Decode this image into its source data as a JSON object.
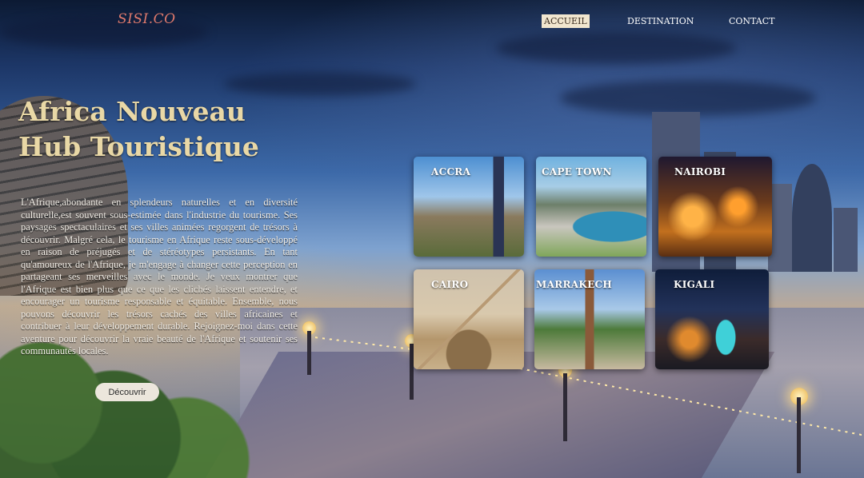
{
  "header": {
    "logo": "SISI.CO",
    "nav": [
      {
        "label": "ACCUEIL",
        "active": true
      },
      {
        "label": "DESTINATION",
        "active": false
      },
      {
        "label": "CONTACT",
        "active": false
      }
    ]
  },
  "hero": {
    "title_line1": "Africa Nouveau",
    "title_line2": "Hub Touristique",
    "paragraph": "L'Afrique,abondante en splendeurs naturelles et en diversité culturelle,est souvent sous-estimée dans l'industrie du tourisme. Ses paysages spectaculaires et ses villes animées regorgent de trésors à découvrir. Malgré cela, le tourisme en Afrique reste sous-développé en raison de préjugés et de stéréotypes persistants. En tant qu'amoureux de l'Afrique, je m'engage à changer cette perception en partageant ses merveilles avec le monde. Je veux montrer que l'Afrique est bien plus que ce que les clichés laissent entendre, et encourager un tourisme responsable et équitable. Ensemble, nous pouvons découvrir les trésors cachés des villes africaines et contribuer à leur développement durable. Rejoignez-moi dans cette aventure pour découvrir la vraie beauté de l'Afrique et soutenir ses communautés locales.",
    "cta_label": "Découvrir"
  },
  "destinations": [
    {
      "name": "ACCRA"
    },
    {
      "name": "CAPE TOWN"
    },
    {
      "name": "NAIROBI"
    },
    {
      "name": "CAIRO"
    },
    {
      "name": "MARRAKECH"
    },
    {
      "name": "KIGALI"
    }
  ],
  "colors": {
    "logo": "#e07a6c",
    "title": "#e9d8a6",
    "active_nav_bg": "#f1e6cf",
    "button_bg": "#ece6dc"
  }
}
